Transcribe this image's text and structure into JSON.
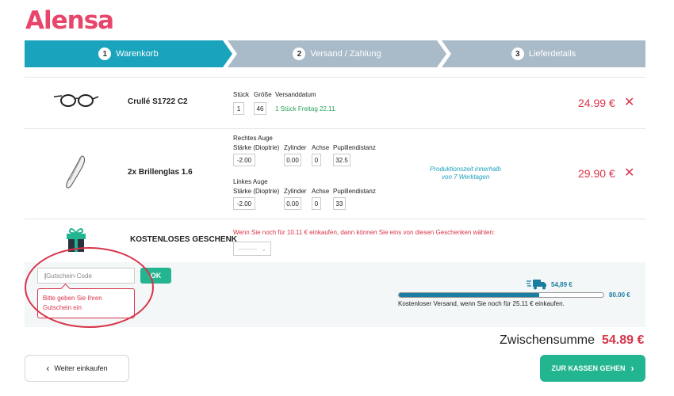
{
  "brand": {
    "logo": "Alensa"
  },
  "steps": [
    {
      "num": "1",
      "label": "Warenkorb"
    },
    {
      "num": "2",
      "label": "Versand / Zahlung"
    },
    {
      "num": "3",
      "label": "Lieferdetails"
    }
  ],
  "item1": {
    "name": "Crullé S1722 C2",
    "col_qty": "Stück",
    "col_size": "Größe",
    "col_ship": "Versanddatum",
    "qty": "1",
    "size": "46",
    "ship_text": "1 Stück  Freitag 22.11.",
    "price": "24.99 €",
    "remove": "✕"
  },
  "item2": {
    "name": "2x Brillenglas 1.6",
    "right_eye": "Rechtes Auge",
    "left_eye": "Linkes Auge",
    "col_power": "Stärke (Dioptrie)",
    "col_cyl": "Zylinder",
    "col_axis": "Achse",
    "col_pd": "Pupillendistanz",
    "right": {
      "power": "-2.00",
      "cyl": "0.00",
      "axis": "0",
      "pd": "32.5"
    },
    "left": {
      "power": "-2.00",
      "cyl": "0.00",
      "axis": "0",
      "pd": "33"
    },
    "production": "Produktionszeit innerhalb",
    "production2": "von 7 Werktagen",
    "price": "29.90 €",
    "remove": "✕"
  },
  "gift": {
    "title": "KOSTENLOSES GESCHENK",
    "message": "Wenn Sie noch für 10.11 € einkaufen, dann können Sie eins von diesen Geschenken wählen:",
    "select_value": "———"
  },
  "coupon": {
    "placeholder": "Gutschein-Code",
    "ok": "OK",
    "error": "Bitte geben Sie Ihren Gutschein ein"
  },
  "shipping": {
    "current": "54,89 €",
    "target": "80.00 €",
    "progress_fraction": 0.686,
    "note": "Kostenloser Versand, wenn Sie noch für 25.11 € einkaufen."
  },
  "subtotal": {
    "label": "Zwischensumme",
    "value": "54.89 €"
  },
  "actions": {
    "back": "Weiter einkaufen",
    "checkout": "ZUR KASSEN GEHEN"
  },
  "colors": {
    "brand": "#e8456a",
    "accent": "#1aa3bd",
    "price": "#d8344a",
    "cta": "#22b58f"
  }
}
